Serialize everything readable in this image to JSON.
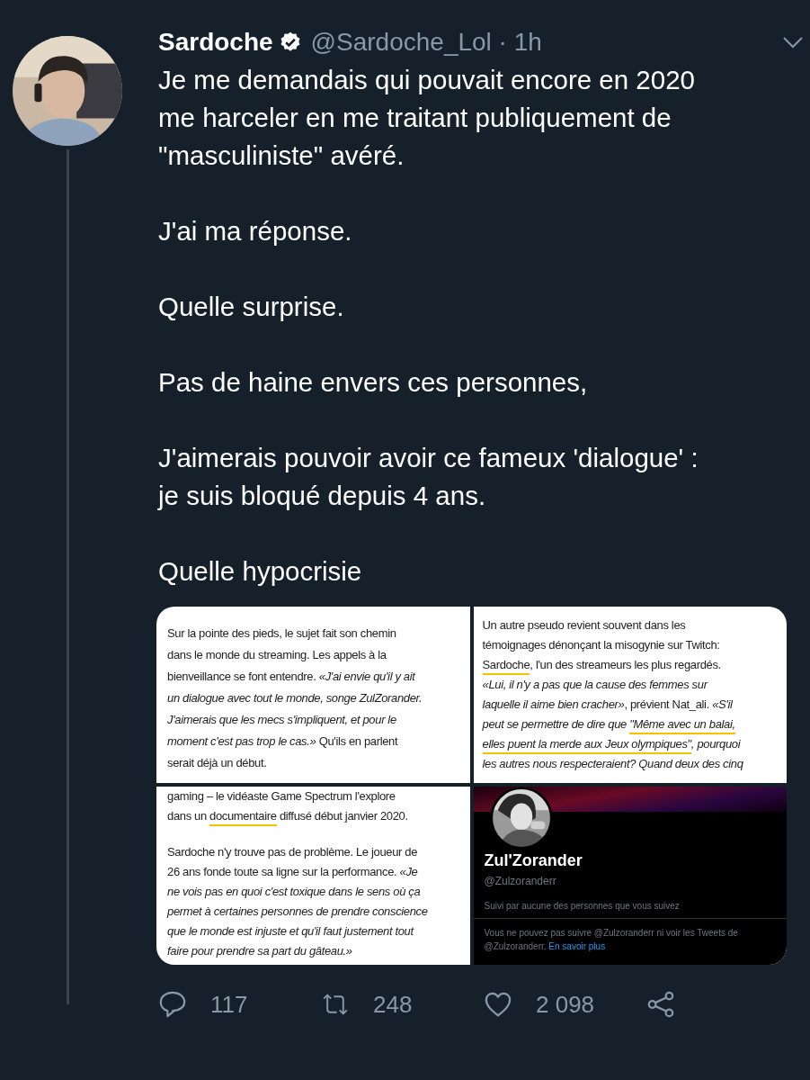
{
  "tweet": {
    "author": {
      "name": "Sardoche",
      "verified": true,
      "meta": "@Sardoche_Lol · 1h"
    },
    "paragraphs": [
      [
        "Je me demandais qui pouvait encore en 2020",
        "me harceler en me traitant publiquement de",
        "\"masculiniste\" avéré."
      ],
      [
        "J'ai ma réponse."
      ],
      [
        "Quelle surprise."
      ],
      [
        "Pas de haine envers ces personnes,"
      ],
      [
        "J'aimerais pouvoir avoir ce fameux 'dialogue' :",
        "je suis bloqué depuis 4 ans."
      ],
      [
        "Quelle hypocrisie"
      ]
    ],
    "media": [
      {
        "kind": "article",
        "paragraphs": [
          [
            [
              {
                "text": "Sur la pointe des pieds, le sujet fait son chemin",
                "highlighted": false
              }
            ],
            [
              {
                "text": "dans le monde du streaming. Les appels à la",
                "highlighted": false
              }
            ],
            [
              {
                "text": "bienveillance se font entendre. *«J'ai envie qu'il y ait*",
                "highlighted": false
              }
            ],
            [
              {
                "text": "*un dialogue avec tout le monde, songe ZulZorander.*",
                "highlighted": false
              }
            ],
            [
              {
                "text": "*J'aimerais que les mecs s'impliquent, et pour le*",
                "highlighted": false
              }
            ],
            [
              {
                "text": "*moment c'est pas trop le cas.»* Qu'ils en parlent",
                "highlighted": false
              }
            ],
            [
              {
                "text": "serait déjà un début.",
                "highlighted": false
              }
            ]
          ]
        ]
      },
      {
        "kind": "article",
        "paragraphs": [
          [
            [
              {
                "text": "Un autre pseudo revient souvent dans les",
                "highlighted": false
              }
            ],
            [
              {
                "text": "témoignages dénonçant la misogynie sur Twitch:",
                "highlighted": false
              }
            ],
            [
              {
                "text": "Sardoche",
                "highlighted": true
              },
              {
                "text": ", l'un des streameurs les plus regardés.",
                "highlighted": false
              }
            ],
            [
              {
                "text": "*«Lui, il n'y a pas que la cause des femmes sur*",
                "highlighted": false
              }
            ],
            [
              {
                "text": "*laquelle il aime bien cracher»*, prévient Nat_ali. *«S'il*",
                "highlighted": false
              }
            ],
            [
              {
                "text": "*peut se permettre de dire que* ",
                "highlighted": false
              },
              {
                "text": "*\"Même avec un balai,*",
                "highlighted": true
              }
            ],
            [
              {
                "text": "*elles puent la merde aux Jeux olympiques\"*",
                "highlighted": true
              },
              {
                "text": "*, pourquoi*",
                "highlighted": false
              }
            ],
            [
              {
                "text": "*les autres nous respecteraient? Quand deux des cinq*",
                "highlighted": false
              }
            ]
          ]
        ]
      },
      {
        "kind": "article",
        "paragraphs": [
          [
            [
              {
                "text": "gaming – le vidéaste Game Spectrum l'explore",
                "highlighted": false
              }
            ],
            [
              {
                "text": "dans un ",
                "highlighted": false
              },
              {
                "text": "documentaire",
                "highlighted": true
              },
              {
                "text": " diffusé début janvier 2020.",
                "highlighted": false
              }
            ]
          ],
          [
            [
              {
                "text": "Sardoche n'y trouve pas de problème. Le joueur de",
                "highlighted": false
              }
            ],
            [
              {
                "text": "26 ans fonde toute sa ligne sur la performance. *«Je*",
                "highlighted": false
              }
            ],
            [
              {
                "text": "*ne vois pas en quoi c'est toxique dans le sens où ça*",
                "highlighted": false
              }
            ],
            [
              {
                "text": "*permet à certaines personnes de prendre conscience*",
                "highlighted": false
              }
            ],
            [
              {
                "text": "*que le monde est injuste et qu'il faut justement tout*",
                "highlighted": false
              }
            ],
            [
              {
                "text": "*faire pour prendre sa part du gâteau.»*",
                "highlighted": false
              }
            ]
          ]
        ]
      },
      {
        "kind": "profile",
        "name": "Zul'Zorander",
        "handle": "@Zulzoranderr",
        "followed_by": "Suivi par aucune des personnes que vous suivez",
        "notice": "Vous ne pouvez pas suivre @Zulzoranderr ni voir les Tweets de @Zulzoranderr.",
        "link": "En savoir plus"
      }
    ],
    "actions": [
      {
        "kind": "reply",
        "count": "117"
      },
      {
        "kind": "retweet",
        "count": "248"
      },
      {
        "kind": "like",
        "count": "2 098"
      },
      {
        "kind": "share"
      }
    ]
  }
}
